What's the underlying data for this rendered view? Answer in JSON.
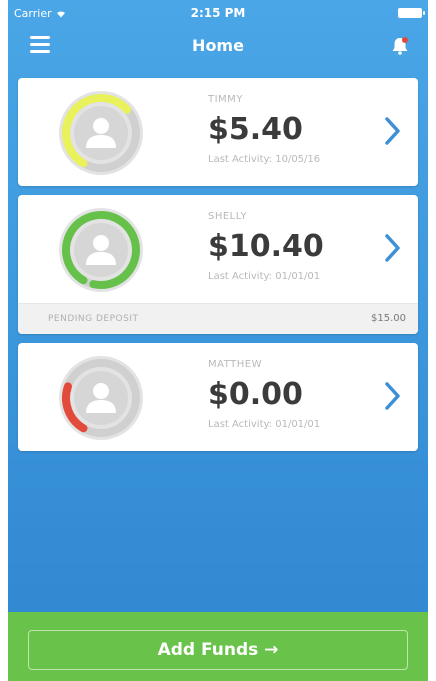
{
  "status_bar": {
    "carrier": "Carrier",
    "time": "2:15 PM"
  },
  "nav": {
    "title": "Home"
  },
  "colors": {
    "accent_blue": "#3d98dd",
    "green": "#69c24a",
    "yellow": "#e9f25a",
    "red": "#e24a3b"
  },
  "accounts": [
    {
      "name": "TIMMY",
      "balance": "$5.40",
      "last_activity": "Last Activity: 10/05/16",
      "ring_color": "#e9f25a",
      "ring_fraction": 0.55
    },
    {
      "name": "SHELLY",
      "balance": "$10.40",
      "last_activity": "Last Activity: 01/01/01",
      "ring_color": "#66c14a",
      "ring_fraction": 0.95,
      "pending": {
        "label": "PENDING DEPOSIT",
        "amount": "$15.00"
      }
    },
    {
      "name": "MATTHEW",
      "balance": "$0.00",
      "last_activity": "Last Activity: 01/01/01",
      "ring_color": "#e24a3b",
      "ring_fraction": 0.22
    }
  ],
  "footer": {
    "add_funds_label": "Add Funds →"
  }
}
